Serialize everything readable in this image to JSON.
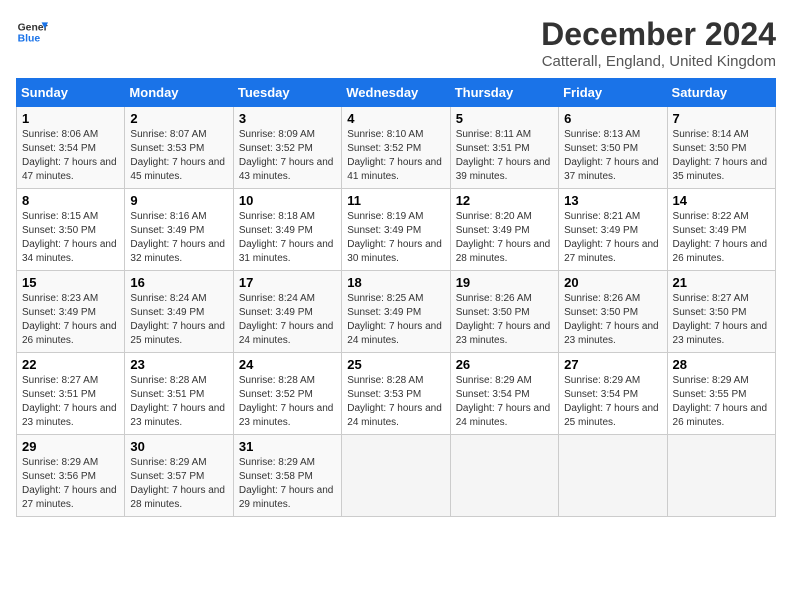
{
  "logo": {
    "line1": "General",
    "line2": "Blue"
  },
  "title": "December 2024",
  "subtitle": "Catterall, England, United Kingdom",
  "days_of_week": [
    "Sunday",
    "Monday",
    "Tuesday",
    "Wednesday",
    "Thursday",
    "Friday",
    "Saturday"
  ],
  "weeks": [
    [
      {
        "day": "1",
        "sunrise": "8:06 AM",
        "sunset": "3:54 PM",
        "daylight": "7 hours and 47 minutes."
      },
      {
        "day": "2",
        "sunrise": "8:07 AM",
        "sunset": "3:53 PM",
        "daylight": "7 hours and 45 minutes."
      },
      {
        "day": "3",
        "sunrise": "8:09 AM",
        "sunset": "3:52 PM",
        "daylight": "7 hours and 43 minutes."
      },
      {
        "day": "4",
        "sunrise": "8:10 AM",
        "sunset": "3:52 PM",
        "daylight": "7 hours and 41 minutes."
      },
      {
        "day": "5",
        "sunrise": "8:11 AM",
        "sunset": "3:51 PM",
        "daylight": "7 hours and 39 minutes."
      },
      {
        "day": "6",
        "sunrise": "8:13 AM",
        "sunset": "3:50 PM",
        "daylight": "7 hours and 37 minutes."
      },
      {
        "day": "7",
        "sunrise": "8:14 AM",
        "sunset": "3:50 PM",
        "daylight": "7 hours and 35 minutes."
      }
    ],
    [
      {
        "day": "8",
        "sunrise": "8:15 AM",
        "sunset": "3:50 PM",
        "daylight": "7 hours and 34 minutes."
      },
      {
        "day": "9",
        "sunrise": "8:16 AM",
        "sunset": "3:49 PM",
        "daylight": "7 hours and 32 minutes."
      },
      {
        "day": "10",
        "sunrise": "8:18 AM",
        "sunset": "3:49 PM",
        "daylight": "7 hours and 31 minutes."
      },
      {
        "day": "11",
        "sunrise": "8:19 AM",
        "sunset": "3:49 PM",
        "daylight": "7 hours and 30 minutes."
      },
      {
        "day": "12",
        "sunrise": "8:20 AM",
        "sunset": "3:49 PM",
        "daylight": "7 hours and 28 minutes."
      },
      {
        "day": "13",
        "sunrise": "8:21 AM",
        "sunset": "3:49 PM",
        "daylight": "7 hours and 27 minutes."
      },
      {
        "day": "14",
        "sunrise": "8:22 AM",
        "sunset": "3:49 PM",
        "daylight": "7 hours and 26 minutes."
      }
    ],
    [
      {
        "day": "15",
        "sunrise": "8:23 AM",
        "sunset": "3:49 PM",
        "daylight": "7 hours and 26 minutes."
      },
      {
        "day": "16",
        "sunrise": "8:24 AM",
        "sunset": "3:49 PM",
        "daylight": "7 hours and 25 minutes."
      },
      {
        "day": "17",
        "sunrise": "8:24 AM",
        "sunset": "3:49 PM",
        "daylight": "7 hours and 24 minutes."
      },
      {
        "day": "18",
        "sunrise": "8:25 AM",
        "sunset": "3:49 PM",
        "daylight": "7 hours and 24 minutes."
      },
      {
        "day": "19",
        "sunrise": "8:26 AM",
        "sunset": "3:50 PM",
        "daylight": "7 hours and 23 minutes."
      },
      {
        "day": "20",
        "sunrise": "8:26 AM",
        "sunset": "3:50 PM",
        "daylight": "7 hours and 23 minutes."
      },
      {
        "day": "21",
        "sunrise": "8:27 AM",
        "sunset": "3:50 PM",
        "daylight": "7 hours and 23 minutes."
      }
    ],
    [
      {
        "day": "22",
        "sunrise": "8:27 AM",
        "sunset": "3:51 PM",
        "daylight": "7 hours and 23 minutes."
      },
      {
        "day": "23",
        "sunrise": "8:28 AM",
        "sunset": "3:51 PM",
        "daylight": "7 hours and 23 minutes."
      },
      {
        "day": "24",
        "sunrise": "8:28 AM",
        "sunset": "3:52 PM",
        "daylight": "7 hours and 23 minutes."
      },
      {
        "day": "25",
        "sunrise": "8:28 AM",
        "sunset": "3:53 PM",
        "daylight": "7 hours and 24 minutes."
      },
      {
        "day": "26",
        "sunrise": "8:29 AM",
        "sunset": "3:54 PM",
        "daylight": "7 hours and 24 minutes."
      },
      {
        "day": "27",
        "sunrise": "8:29 AM",
        "sunset": "3:54 PM",
        "daylight": "7 hours and 25 minutes."
      },
      {
        "day": "28",
        "sunrise": "8:29 AM",
        "sunset": "3:55 PM",
        "daylight": "7 hours and 26 minutes."
      }
    ],
    [
      {
        "day": "29",
        "sunrise": "8:29 AM",
        "sunset": "3:56 PM",
        "daylight": "7 hours and 27 minutes."
      },
      {
        "day": "30",
        "sunrise": "8:29 AM",
        "sunset": "3:57 PM",
        "daylight": "7 hours and 28 minutes."
      },
      {
        "day": "31",
        "sunrise": "8:29 AM",
        "sunset": "3:58 PM",
        "daylight": "7 hours and 29 minutes."
      },
      null,
      null,
      null,
      null
    ]
  ],
  "labels": {
    "sunrise": "Sunrise:",
    "sunset": "Sunset:",
    "daylight": "Daylight:"
  }
}
